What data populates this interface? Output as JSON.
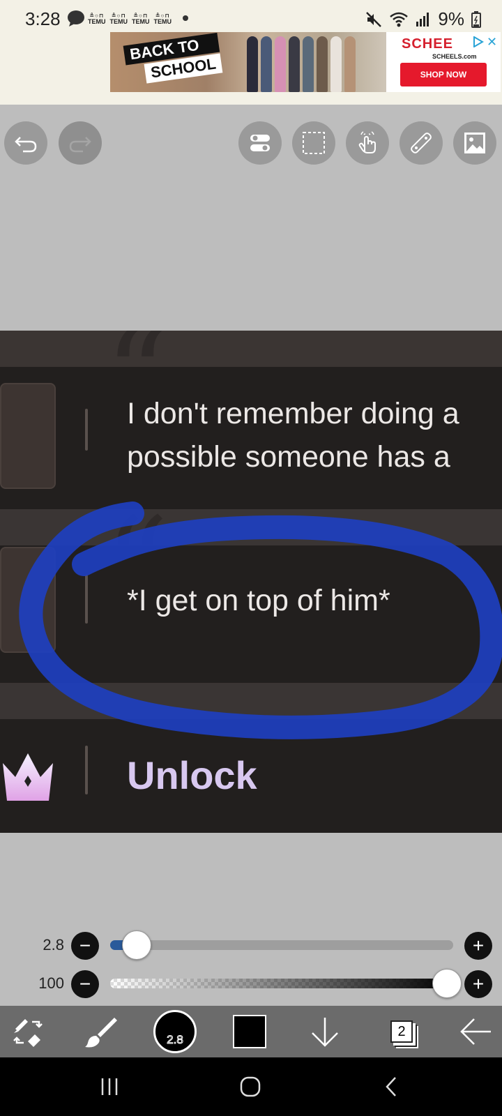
{
  "status_bar": {
    "time": "3:28",
    "notifications": [
      "TEMU",
      "TEMU",
      "TEMU",
      "TEMU"
    ],
    "battery": "9%",
    "icons": [
      "chat-icon",
      "mute-icon",
      "wifi-icon",
      "signal-icon",
      "battery-icon"
    ]
  },
  "ad": {
    "headline_line1": "BACK TO",
    "headline_line2": "SCHOOL",
    "brand": "SCHEE",
    "brand_url": "SCHEELS.com",
    "cta": "SHOP NOW",
    "close": "✕"
  },
  "toolbar": {
    "left": [
      "undo-icon",
      "redo-icon"
    ],
    "right": [
      "toggle-icon",
      "selection-icon",
      "touch-icon",
      "ruler-icon",
      "image-icon"
    ]
  },
  "canvas": {
    "message1_line1": "I don't remember doing a",
    "message1_line2": "possible someone has a",
    "message2": "*I get on top of him*",
    "unlock": "Unlock",
    "annotation_color": "#1e3fbf"
  },
  "sliders": {
    "brush_size": {
      "value": "2.8",
      "fraction": 0.06
    },
    "opacity": {
      "value": "100",
      "fraction": 1.0
    },
    "minus": "−",
    "plus": "+"
  },
  "bottom_bar": {
    "brush_size_label": "2.8",
    "layer_count": "2",
    "tools": [
      "tool-swap-icon",
      "brush-icon",
      "color-picker",
      "secondary-color",
      "down-arrow-icon",
      "layers-icon",
      "back-arrow-icon"
    ]
  },
  "colors": {
    "accent": "#2a5a9a",
    "primary_color": "#000000"
  }
}
